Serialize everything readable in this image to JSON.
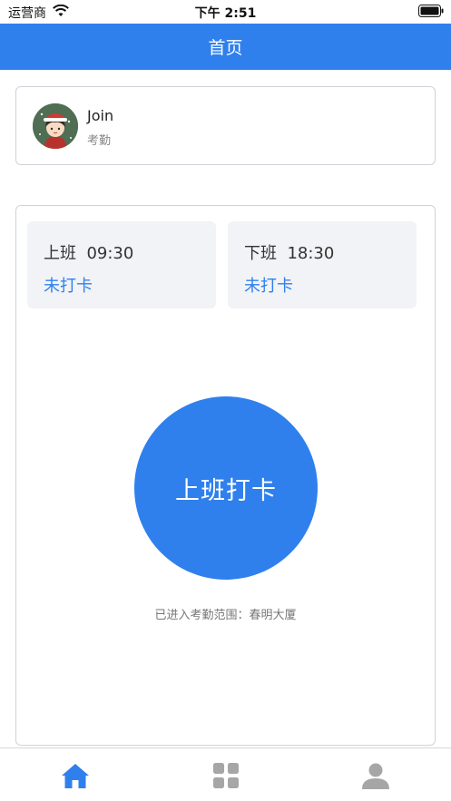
{
  "status_bar": {
    "carrier": "运营商",
    "time": "下午 2:51"
  },
  "header": {
    "title": "首页"
  },
  "user": {
    "name": "Join",
    "subtitle": "考勤"
  },
  "shifts": [
    {
      "title": "上班  09:30",
      "status": "未打卡"
    },
    {
      "title": "下班  18:30",
      "status": "未打卡"
    }
  ],
  "punch": {
    "label": "上班打卡",
    "range_text": "已进入考勤范围：春明大厦"
  },
  "tabs": [
    {
      "icon": "home-icon",
      "active": true
    },
    {
      "icon": "grid-icon",
      "active": false
    },
    {
      "icon": "person-icon",
      "active": false
    }
  ],
  "colors": {
    "accent": "#2f80ed",
    "inactive_icon": "#a6a6a6",
    "shift_bg": "#f2f3f6"
  }
}
